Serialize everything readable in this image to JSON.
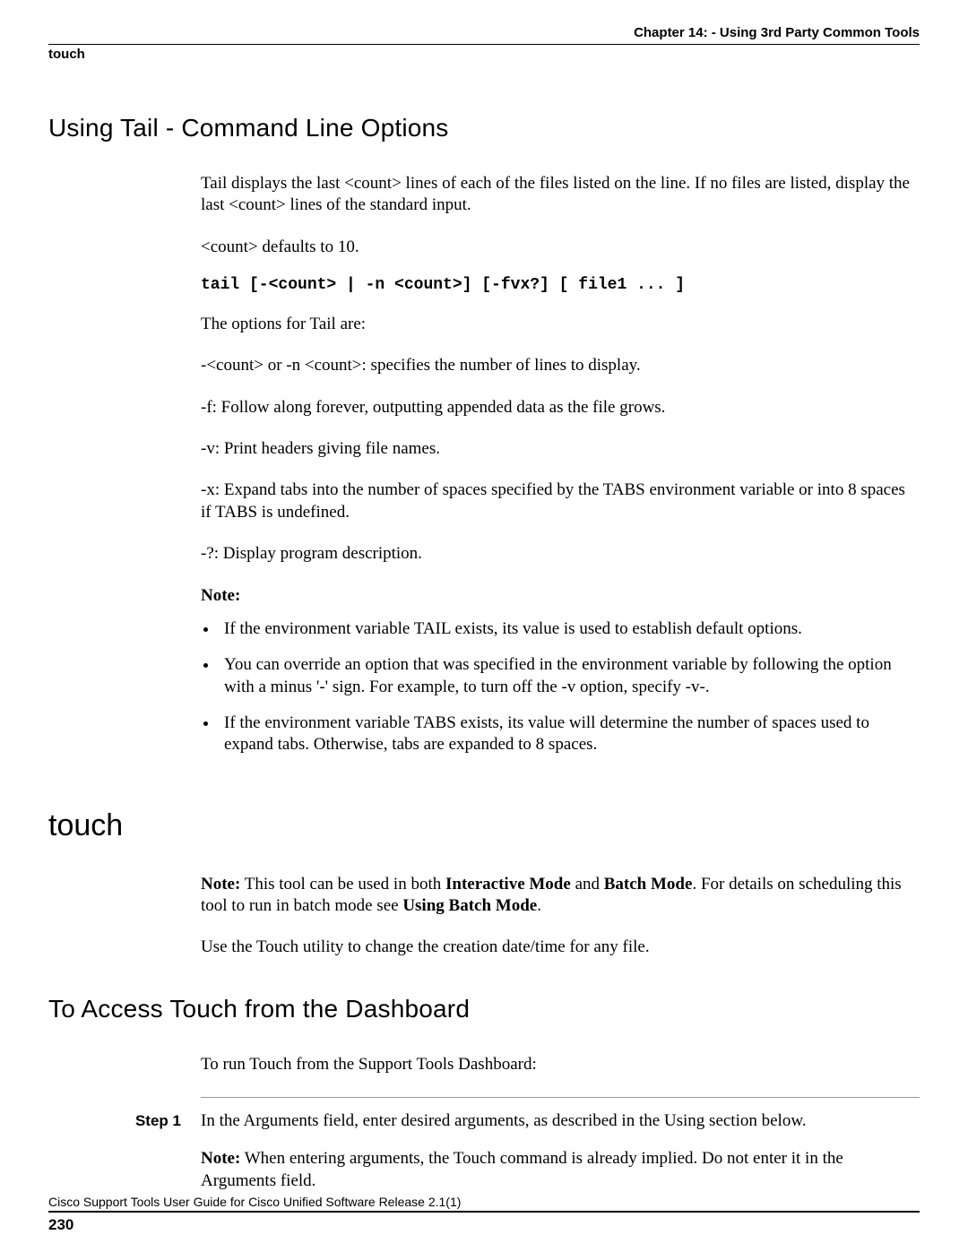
{
  "header": {
    "chapter": "Chapter 14: - Using 3rd Party Common Tools",
    "running_head": "touch"
  },
  "sections": {
    "tail": {
      "heading": "Using Tail - Command Line Options",
      "intro1": "Tail displays the last <count> lines of each of the files listed on the line. If no files are listed, display the last <count> lines of the standard input.",
      "intro2": "<count> defaults to 10.",
      "syntax": "tail [-<count> | -n <count>] [-fvx?] [ file1 ... ]",
      "options_intro": "The options for Tail are:",
      "opt_count": "-<count> or -n <count>: specifies the number of lines to display.",
      "opt_f": "-f: Follow along forever, outputting appended data as the file grows.",
      "opt_v": "-v: Print headers giving file names.",
      "opt_x": "-x: Expand tabs into the number of spaces specified by the TABS environment variable or into 8 spaces if TABS is undefined.",
      "opt_q": "-?: Display program description.",
      "notes_label": "Note:",
      "note1": "If the environment variable TAIL exists, its value is used to establish default options.",
      "note2": "You can override an option that was specified in the environment variable by following the option with a minus '-' sign. For example, to turn off the -v option, specify -v-.",
      "note3": "If the environment variable TABS exists, its value will determine the number of spaces used to expand tabs. Otherwise, tabs are expanded to 8 spaces."
    },
    "touch": {
      "heading": "touch",
      "note_prefix": "Note:",
      "note_seg1": " This tool can be used in both ",
      "note_bold1": "Interactive Mode",
      "note_seg2": " and ",
      "note_bold2": "Batch Mode",
      "note_seg3": ". For details on scheduling this tool to run in batch mode see ",
      "note_bold3": "Using Batch Mode",
      "note_seg4": ".",
      "desc": "Use the Touch utility to change the creation date/time for any file."
    },
    "access": {
      "heading": "To Access Touch from the Dashboard",
      "intro": "To run Touch from the Support Tools Dashboard:",
      "step1_label": "Step 1",
      "step1_text": "In the Arguments field, enter desired arguments, as described in the Using section below.",
      "step1_note_prefix": "Note:",
      "step1_note_rest": " When entering arguments, the Touch command is already implied. Do not enter it in the Arguments field."
    }
  },
  "footer": {
    "title": "Cisco Support Tools User Guide for Cisco Unified Software Release 2.1(1)",
    "page": "230"
  }
}
